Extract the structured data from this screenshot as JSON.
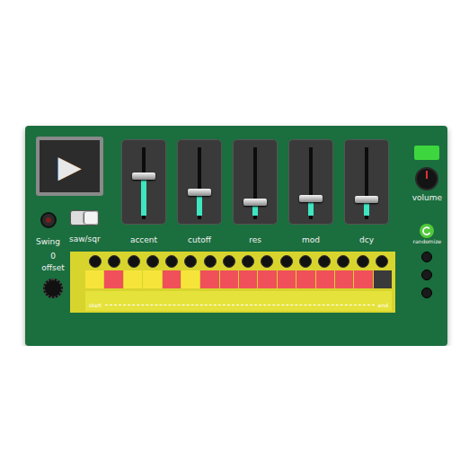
{
  "play": {
    "icon": "▶"
  },
  "swing": {
    "label": "Swing",
    "on": false
  },
  "waveform": {
    "label": "saw/sqr",
    "on": true
  },
  "sliders": [
    {
      "label": "accent",
      "level": 0.6
    },
    {
      "label": "cutoff",
      "level": 0.38
    },
    {
      "label": "res",
      "level": 0.24
    },
    {
      "label": "mod",
      "level": 0.29
    },
    {
      "label": "dcy",
      "level": 0.28
    }
  ],
  "indicator": {
    "on": true
  },
  "volume": {
    "label": "volume",
    "level": 0.5
  },
  "randomize": {
    "label": "randomize"
  },
  "sequencer": {
    "offset": {
      "value": "0",
      "label": "offset"
    },
    "steps": [
      {
        "color": "#f7e43a"
      },
      {
        "color": "#f0505a"
      },
      {
        "color": "#f7e43a"
      },
      {
        "color": "#f7e43a"
      },
      {
        "color": "#f0505a"
      },
      {
        "color": "#f7e43a"
      },
      {
        "color": "#f0505a"
      },
      {
        "color": "#f0505a"
      },
      {
        "color": "#f0505a"
      },
      {
        "color": "#f0505a"
      },
      {
        "color": "#f0505a"
      },
      {
        "color": "#f0505a"
      },
      {
        "color": "#f0505a"
      },
      {
        "color": "#f0505a"
      },
      {
        "color": "#f0505a"
      },
      {
        "color": "#3a3a3a"
      }
    ],
    "range": {
      "start": "start",
      "end": "end"
    }
  }
}
